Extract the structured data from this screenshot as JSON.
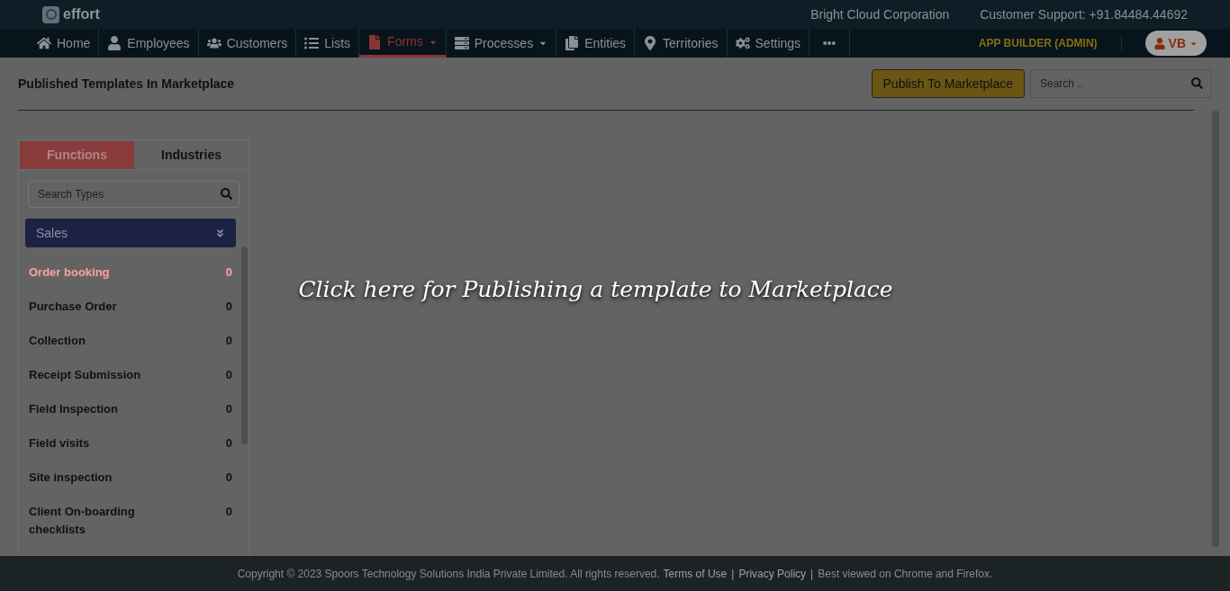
{
  "brand": "effort",
  "company": "Bright Cloud Corporation",
  "support": "Customer Support: +91.84484.44692",
  "nav": [
    {
      "label": "Home",
      "selected": false,
      "caret": false
    },
    {
      "label": "Employees",
      "selected": false,
      "caret": false
    },
    {
      "label": "Customers",
      "selected": false,
      "caret": false
    },
    {
      "label": "Lists",
      "selected": false,
      "caret": false
    },
    {
      "label": "Forms",
      "selected": true,
      "caret": true
    },
    {
      "label": "Processes",
      "selected": false,
      "caret": true
    },
    {
      "label": "Entities",
      "selected": false,
      "caret": false
    },
    {
      "label": "Territories",
      "selected": false,
      "caret": false
    },
    {
      "label": "Settings",
      "selected": false,
      "caret": false
    }
  ],
  "role": "APP BUILDER (ADMIN)",
  "user": "VB",
  "page_title": "Published Templates In Marketplace",
  "publish_button": "Publish To Marketplace",
  "search": {
    "placeholder": "Search .."
  },
  "tabs": [
    {
      "label": "Functions",
      "selected": true
    },
    {
      "label": "Industries",
      "selected": false
    }
  ],
  "type_search": {
    "placeholder": "Search Types"
  },
  "category": "Sales",
  "items": [
    {
      "name": "Order booking",
      "count": "0",
      "selected": true
    },
    {
      "name": "Purchase Order",
      "count": "0",
      "selected": false
    },
    {
      "name": "Collection",
      "count": "0",
      "selected": false
    },
    {
      "name": "Receipt Submission",
      "count": "0",
      "selected": false
    },
    {
      "name": "Field Inspection",
      "count": "0",
      "selected": false
    },
    {
      "name": "Field visits",
      "count": "0",
      "selected": false
    },
    {
      "name": "Site inspection",
      "count": "0",
      "selected": false
    },
    {
      "name": "Client On-boarding checklists",
      "count": "0",
      "selected": false
    }
  ],
  "hint": "Click here for Publishing a template to Marketplace",
  "footer": [
    {
      "kind": "text",
      "text": "Copyright © 2023 Spoors Technology Solutions India Private Limited. All rights reserved."
    },
    {
      "kind": "link",
      "text": "Terms of Use"
    },
    {
      "kind": "separator",
      "text": "|"
    },
    {
      "kind": "link",
      "text": "Privacy Policy"
    },
    {
      "kind": "separator",
      "text": "|"
    },
    {
      "kind": "text",
      "text": "Best viewed on Chrome and Firefox."
    }
  ]
}
